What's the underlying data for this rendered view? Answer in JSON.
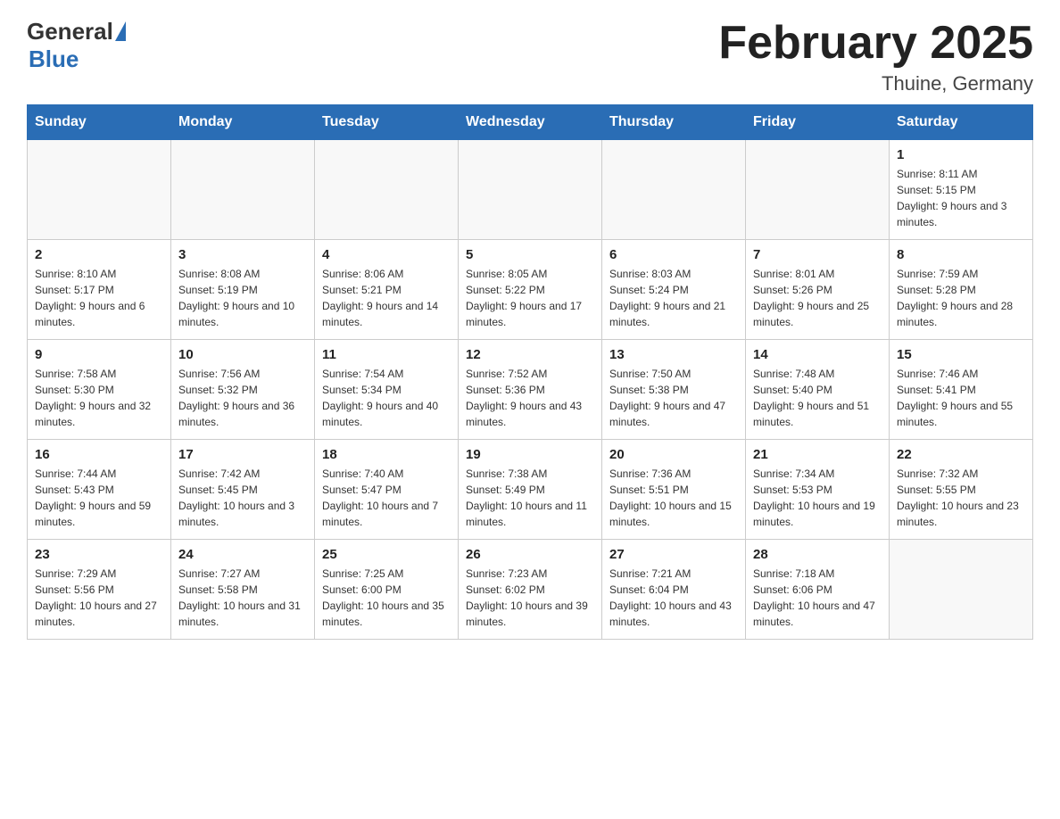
{
  "header": {
    "logo_general": "General",
    "logo_blue": "Blue",
    "month_title": "February 2025",
    "location": "Thuine, Germany"
  },
  "weekdays": [
    "Sunday",
    "Monday",
    "Tuesday",
    "Wednesday",
    "Thursday",
    "Friday",
    "Saturday"
  ],
  "weeks": [
    [
      {
        "day": "",
        "info": ""
      },
      {
        "day": "",
        "info": ""
      },
      {
        "day": "",
        "info": ""
      },
      {
        "day": "",
        "info": ""
      },
      {
        "day": "",
        "info": ""
      },
      {
        "day": "",
        "info": ""
      },
      {
        "day": "1",
        "info": "Sunrise: 8:11 AM\nSunset: 5:15 PM\nDaylight: 9 hours and 3 minutes."
      }
    ],
    [
      {
        "day": "2",
        "info": "Sunrise: 8:10 AM\nSunset: 5:17 PM\nDaylight: 9 hours and 6 minutes."
      },
      {
        "day": "3",
        "info": "Sunrise: 8:08 AM\nSunset: 5:19 PM\nDaylight: 9 hours and 10 minutes."
      },
      {
        "day": "4",
        "info": "Sunrise: 8:06 AM\nSunset: 5:21 PM\nDaylight: 9 hours and 14 minutes."
      },
      {
        "day": "5",
        "info": "Sunrise: 8:05 AM\nSunset: 5:22 PM\nDaylight: 9 hours and 17 minutes."
      },
      {
        "day": "6",
        "info": "Sunrise: 8:03 AM\nSunset: 5:24 PM\nDaylight: 9 hours and 21 minutes."
      },
      {
        "day": "7",
        "info": "Sunrise: 8:01 AM\nSunset: 5:26 PM\nDaylight: 9 hours and 25 minutes."
      },
      {
        "day": "8",
        "info": "Sunrise: 7:59 AM\nSunset: 5:28 PM\nDaylight: 9 hours and 28 minutes."
      }
    ],
    [
      {
        "day": "9",
        "info": "Sunrise: 7:58 AM\nSunset: 5:30 PM\nDaylight: 9 hours and 32 minutes."
      },
      {
        "day": "10",
        "info": "Sunrise: 7:56 AM\nSunset: 5:32 PM\nDaylight: 9 hours and 36 minutes."
      },
      {
        "day": "11",
        "info": "Sunrise: 7:54 AM\nSunset: 5:34 PM\nDaylight: 9 hours and 40 minutes."
      },
      {
        "day": "12",
        "info": "Sunrise: 7:52 AM\nSunset: 5:36 PM\nDaylight: 9 hours and 43 minutes."
      },
      {
        "day": "13",
        "info": "Sunrise: 7:50 AM\nSunset: 5:38 PM\nDaylight: 9 hours and 47 minutes."
      },
      {
        "day": "14",
        "info": "Sunrise: 7:48 AM\nSunset: 5:40 PM\nDaylight: 9 hours and 51 minutes."
      },
      {
        "day": "15",
        "info": "Sunrise: 7:46 AM\nSunset: 5:41 PM\nDaylight: 9 hours and 55 minutes."
      }
    ],
    [
      {
        "day": "16",
        "info": "Sunrise: 7:44 AM\nSunset: 5:43 PM\nDaylight: 9 hours and 59 minutes."
      },
      {
        "day": "17",
        "info": "Sunrise: 7:42 AM\nSunset: 5:45 PM\nDaylight: 10 hours and 3 minutes."
      },
      {
        "day": "18",
        "info": "Sunrise: 7:40 AM\nSunset: 5:47 PM\nDaylight: 10 hours and 7 minutes."
      },
      {
        "day": "19",
        "info": "Sunrise: 7:38 AM\nSunset: 5:49 PM\nDaylight: 10 hours and 11 minutes."
      },
      {
        "day": "20",
        "info": "Sunrise: 7:36 AM\nSunset: 5:51 PM\nDaylight: 10 hours and 15 minutes."
      },
      {
        "day": "21",
        "info": "Sunrise: 7:34 AM\nSunset: 5:53 PM\nDaylight: 10 hours and 19 minutes."
      },
      {
        "day": "22",
        "info": "Sunrise: 7:32 AM\nSunset: 5:55 PM\nDaylight: 10 hours and 23 minutes."
      }
    ],
    [
      {
        "day": "23",
        "info": "Sunrise: 7:29 AM\nSunset: 5:56 PM\nDaylight: 10 hours and 27 minutes."
      },
      {
        "day": "24",
        "info": "Sunrise: 7:27 AM\nSunset: 5:58 PM\nDaylight: 10 hours and 31 minutes."
      },
      {
        "day": "25",
        "info": "Sunrise: 7:25 AM\nSunset: 6:00 PM\nDaylight: 10 hours and 35 minutes."
      },
      {
        "day": "26",
        "info": "Sunrise: 7:23 AM\nSunset: 6:02 PM\nDaylight: 10 hours and 39 minutes."
      },
      {
        "day": "27",
        "info": "Sunrise: 7:21 AM\nSunset: 6:04 PM\nDaylight: 10 hours and 43 minutes."
      },
      {
        "day": "28",
        "info": "Sunrise: 7:18 AM\nSunset: 6:06 PM\nDaylight: 10 hours and 47 minutes."
      },
      {
        "day": "",
        "info": ""
      }
    ]
  ]
}
